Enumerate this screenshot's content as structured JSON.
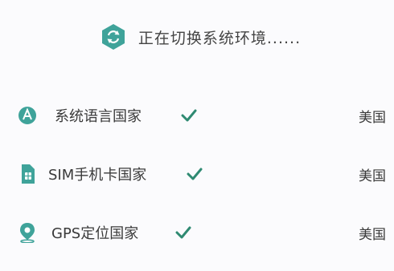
{
  "header": {
    "text": "正在切换系统环境......",
    "icon": "hex-switch-icon",
    "accent": "#3fa39a"
  },
  "rows": [
    {
      "icon": "globe-a-icon",
      "label": "系统语言国家",
      "status": "check",
      "value": "美国"
    },
    {
      "icon": "sim-card-icon",
      "label": "SIM手机卡国家",
      "status": "check",
      "value": "美国"
    },
    {
      "icon": "location-pin-icon",
      "label": "GPS定位国家",
      "status": "check",
      "value": "美国"
    }
  ],
  "colors": {
    "accent": "#3fa39a",
    "check": "#2f8a72",
    "text": "#3a3a3a"
  }
}
